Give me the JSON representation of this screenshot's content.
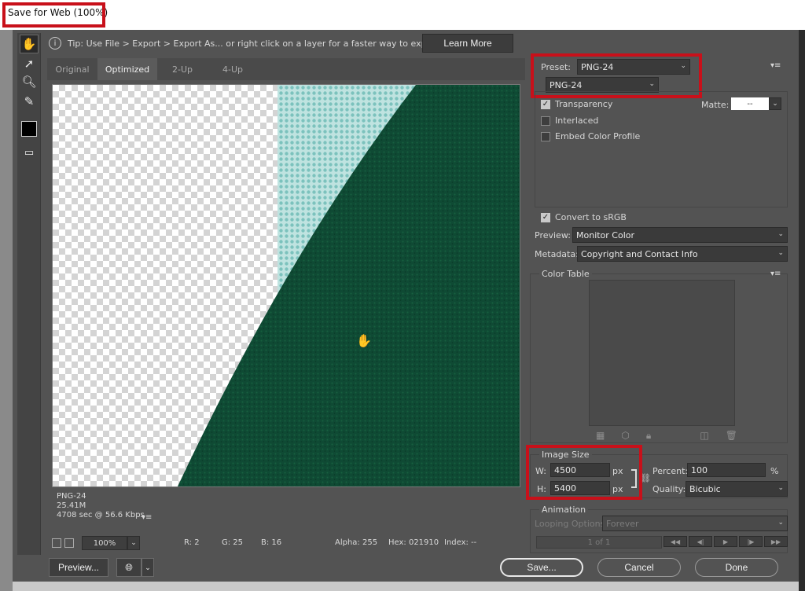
{
  "window": {
    "title": "Save for Web (100%)"
  },
  "tip": {
    "text": "Tip: Use File > Export > Export As...  or right click on a layer for a faster way to export assets",
    "learn_more": "Learn More"
  },
  "tabs": [
    "Original",
    "Optimized",
    "2-Up",
    "4-Up"
  ],
  "image_info": {
    "format": "PNG-24",
    "size": "25.41M",
    "time": "4708 sec @ 56.6 Kbps"
  },
  "status": {
    "zoom": "100%",
    "r": "R: 2",
    "g": "G: 25",
    "b": "B: 16",
    "alpha": "Alpha: 255",
    "hex": "Hex: 021910",
    "index": "Index: --"
  },
  "preset": {
    "label": "Preset:",
    "value": "PNG-24",
    "format": "PNG-24"
  },
  "options": {
    "transparency": "Transparency",
    "interlaced": "Interlaced",
    "embed_profile": "Embed Color Profile",
    "matte_label": "Matte:",
    "matte_value": "--",
    "convert_srgb": "Convert to sRGB",
    "preview_label": "Preview:",
    "preview_value": "Monitor Color",
    "metadata_label": "Metadata:",
    "metadata_value": "Copyright and Contact Info"
  },
  "color_table": {
    "title": "Color Table"
  },
  "image_size": {
    "title": "Image Size",
    "w_label": "W:",
    "w_value": "4500",
    "h_label": "H:",
    "h_value": "5400",
    "unit": "px",
    "percent_label": "Percent:",
    "percent_value": "100",
    "percent_unit": "%",
    "quality_label": "Quality:",
    "quality_value": "Bicubic"
  },
  "animation": {
    "title": "Animation",
    "looping_label": "Looping Options:",
    "looping_value": "Forever",
    "frame_counter": "1 of 1"
  },
  "buttons": {
    "preview": "Preview...",
    "save": "Save...",
    "cancel": "Cancel",
    "done": "Done"
  },
  "colors": {
    "highlight": "#c8101a",
    "dark_green": "#0e4a33",
    "teal": "#9fd3d0",
    "panel": "#535353"
  }
}
